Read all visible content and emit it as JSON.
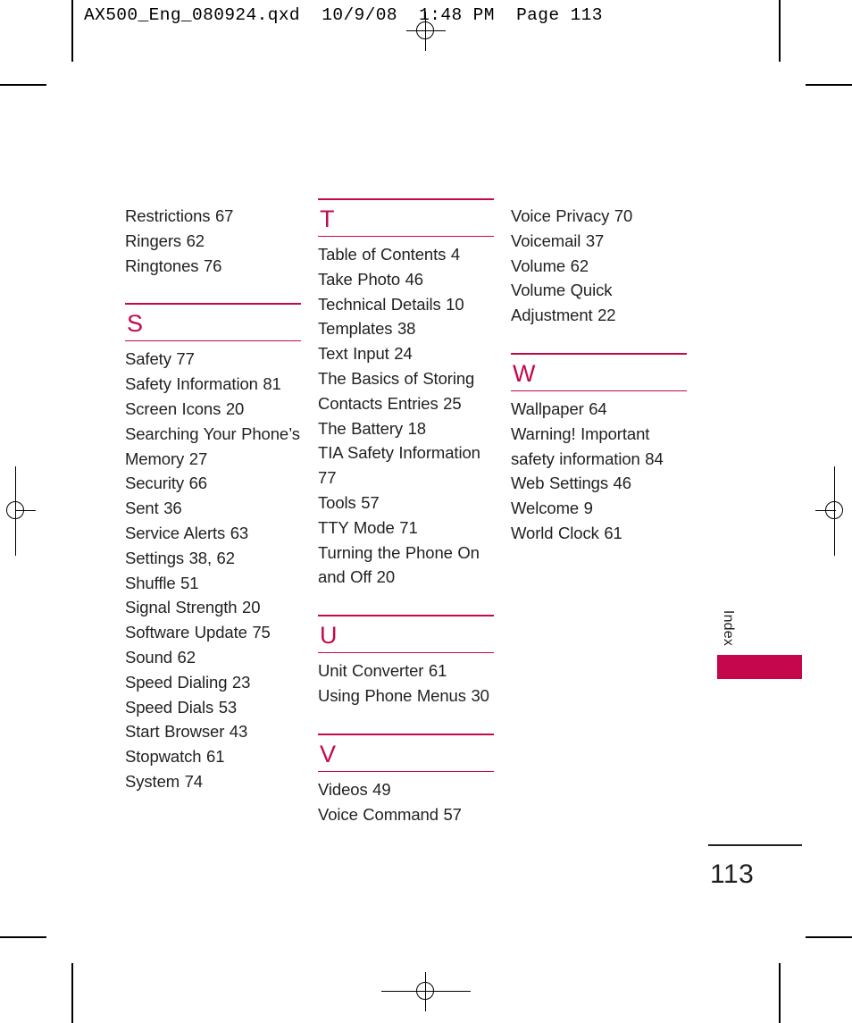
{
  "prepress": {
    "slug": "AX500_Eng_080924.qxd  10/9/08  1:48 PM  Page 113"
  },
  "colors": {
    "accent": "#c5084e",
    "text": "#231f20",
    "background": "#ffffff"
  },
  "sidebar": {
    "tab_label": "Index"
  },
  "folio": {
    "page_number": "113"
  },
  "columns": [
    {
      "id": "column-1",
      "blocks": [
        {
          "type": "entries",
          "items": [
            "Restrictions 67",
            "Ringers 62",
            "Ringtones 76"
          ]
        },
        {
          "type": "section",
          "letter": "S",
          "items": [
            "Safety 77",
            "Safety Information 81",
            "Screen Icons 20",
            "Searching Your Phone’s Memory 27",
            "Security 66",
            "Sent 36",
            "Service Alerts 63",
            "Settings 38, 62",
            "Shuffle 51",
            "Signal Strength 20",
            "Software Update 75",
            "Sound 62",
            "Speed Dialing 23",
            "Speed Dials 53",
            "Start Browser 43",
            "Stopwatch 61",
            "System 74"
          ]
        }
      ]
    },
    {
      "id": "column-2",
      "blocks": [
        {
          "type": "section",
          "letter": "T",
          "items": [
            "Table of Contents 4",
            "Take Photo 46",
            "Technical Details 10",
            "Templates 38",
            "Text Input 24",
            "The Basics of Storing Contacts Entries 25",
            "The Battery 18",
            "TIA Safety Information 77",
            "Tools 57",
            "TTY Mode 71",
            "Turning the Phone On and Off 20"
          ]
        },
        {
          "type": "section",
          "letter": "U",
          "items": [
            "Unit Converter 61",
            "Using Phone Menus 30"
          ]
        },
        {
          "type": "section",
          "letter": "V",
          "items": [
            "Videos 49",
            "Voice Command 57"
          ]
        }
      ]
    },
    {
      "id": "column-3",
      "blocks": [
        {
          "type": "entries",
          "items": [
            "Voice Privacy 70",
            "Voicemail 37",
            "Volume 62",
            "Volume Quick Adjustment 22"
          ]
        },
        {
          "type": "section",
          "letter": "W",
          "items": [
            "Wallpaper 64",
            "Warning! Important safety information 84",
            "Web Settings 46",
            "Welcome 9",
            "World Clock 61"
          ]
        }
      ]
    }
  ]
}
